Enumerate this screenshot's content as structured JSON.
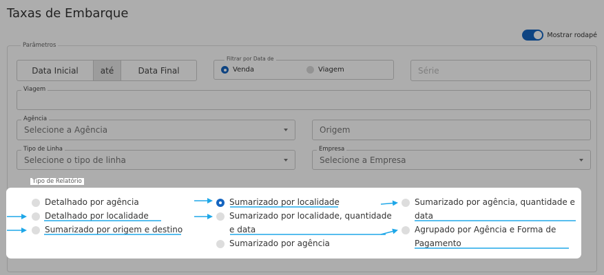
{
  "page": {
    "title": "Taxas de Embarque"
  },
  "footer_toggle": {
    "label": "Mostrar rodapé",
    "checked": true
  },
  "params": {
    "legend": "Parâmetros",
    "date_range": {
      "start": "Data Inicial",
      "separator": "até",
      "end": "Data Final"
    },
    "date_filter": {
      "legend": "Filtrar por Data de",
      "options": [
        "Venda",
        "Viagem"
      ],
      "selected": "Venda"
    },
    "serie": {
      "placeholder": "Série"
    },
    "viagem": {
      "label": "Viagem",
      "value": ""
    },
    "agencia": {
      "label": "Agência",
      "placeholder": "Selecione a Agência"
    },
    "origem": {
      "placeholder": "Origem"
    },
    "tipo_linha": {
      "label": "Tipo de Linha",
      "placeholder": "Selecione o tipo de linha"
    },
    "empresa": {
      "label": "Empresa",
      "placeholder": "Selecione a Empresa"
    }
  },
  "report_type": {
    "legend": "Tipo de Relatório",
    "selected": "Sumarizado por localidade",
    "options": [
      {
        "label": "Detalhado por agência"
      },
      {
        "label": "Detalhado por localidade"
      },
      {
        "label": "Sumarizado por origem e destino"
      },
      {
        "label": "Sumarizado por localidade"
      },
      {
        "line1": "Sumarizado por localidade, quantidade",
        "line2": "e data"
      },
      {
        "label": "Sumarizado por agência"
      },
      {
        "line1": "Sumarizado por agência, quantidade e",
        "line2": "data"
      },
      {
        "line1": "Agrupado por Agência e Forma de",
        "line2": "Pagamento"
      }
    ]
  },
  "annotation": {
    "color": "#1ea7e8"
  },
  "colors": {
    "accent": "#1565c0",
    "overlay": "rgba(0,0,0,0.32)"
  }
}
